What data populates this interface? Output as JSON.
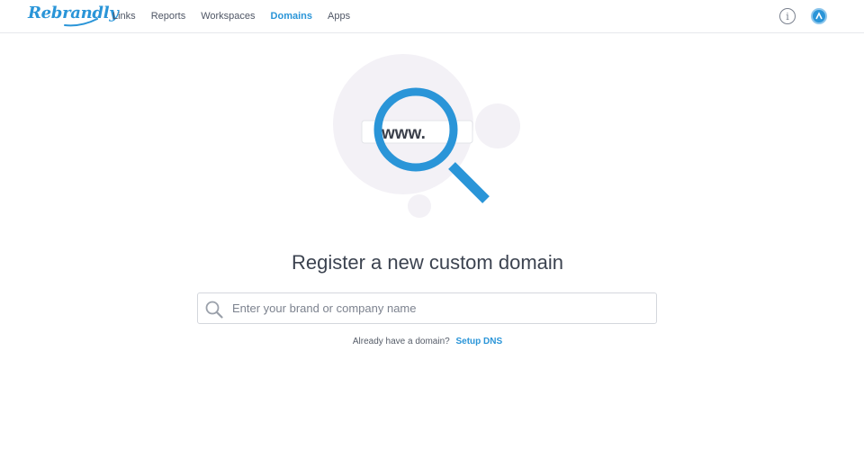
{
  "brand": {
    "logo_text": "Rebrandly"
  },
  "nav": {
    "items": [
      {
        "label": "Links",
        "active": false
      },
      {
        "label": "Reports",
        "active": false
      },
      {
        "label": "Workspaces",
        "active": false
      },
      {
        "label": "Domains",
        "active": true
      },
      {
        "label": "Apps",
        "active": false
      }
    ]
  },
  "header_icons": {
    "info": "info-icon",
    "avatar": "user-avatar-icon"
  },
  "illustration": {
    "url_prefix": "www.",
    "icon": "magnifier-icon"
  },
  "main": {
    "headline": "Register a new custom domain",
    "search_placeholder": "Enter your brand or company name",
    "search_value": "",
    "hint_text": "Already have a domain?",
    "hint_link": "Setup DNS"
  },
  "colors": {
    "accent": "#2a95d8",
    "text": "#3c4350",
    "blob": "#f3f1f6"
  }
}
